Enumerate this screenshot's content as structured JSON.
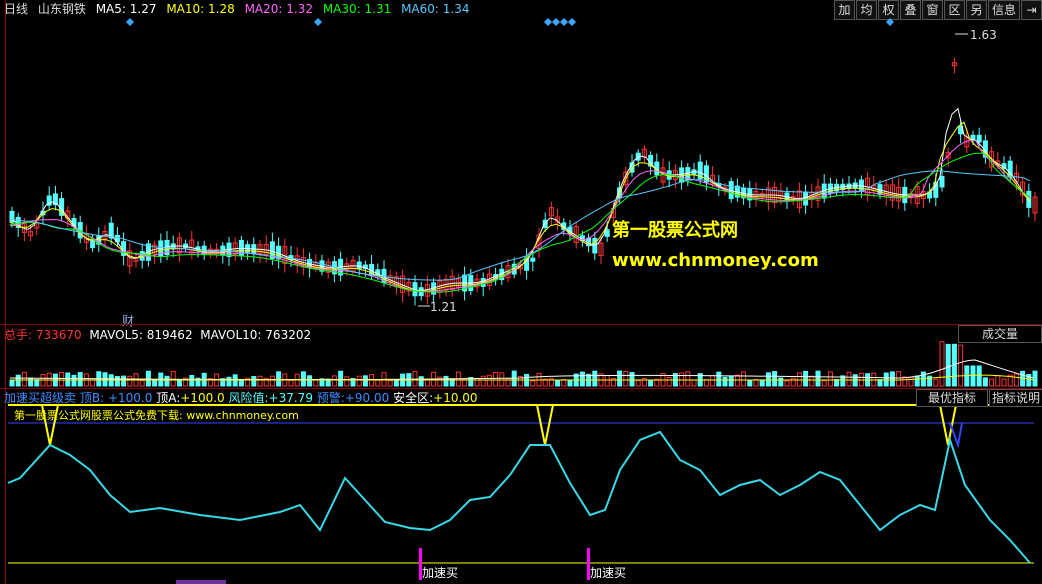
{
  "header": {
    "period": "日线",
    "stock": "山东钢铁",
    "ma": [
      {
        "label": "MA5:",
        "value": "1.27",
        "color": "#ffffff"
      },
      {
        "label": "MA10:",
        "value": "1.28",
        "color": "#ffff00"
      },
      {
        "label": "MA20:",
        "value": "1.32",
        "color": "#ff66ff"
      },
      {
        "label": "MA30:",
        "value": "1.31",
        "color": "#00ff00"
      },
      {
        "label": "MA60:",
        "value": "1.34",
        "color": "#55c8ff"
      }
    ]
  },
  "toolbar": [
    "加",
    "均",
    "权",
    "叠",
    "窗",
    "区",
    "另",
    "信息",
    "⇥"
  ],
  "price_panel": {
    "high_label": "1.63",
    "low_label": "1.21",
    "cai": "财",
    "watermark1": "第一股票公式网",
    "watermark2": "www.chnmoney.com"
  },
  "volume_panel": {
    "total_label": "总手:",
    "total_value": "733670",
    "mavol5_label": "MAVOL5:",
    "mavol5_value": "819462",
    "mavol10_label": "MAVOL10:",
    "mavol10_value": "763202",
    "dropdown": "成交量"
  },
  "indicator_panel": {
    "name": "加速买超级卖",
    "bottom_label": "顶B:",
    "bottom_value": "+100.0",
    "topA_label": "顶A:",
    "topA_value": "+100.0",
    "risk_label": "风险值:",
    "risk_value": "+37.79",
    "warn_label": "预警:",
    "warn_value": "+90.00",
    "safe_label": "安全区:",
    "safe_value": "+10.00",
    "banner": "第一股票公式网股票公式免费下载: www.chnmoney.com",
    "best_button": "最优指标",
    "explain_button": "指标说明",
    "buy_signals": [
      "加速买",
      "加速买"
    ]
  },
  "colors": {
    "up": "#ff3232",
    "down": "#54ffff",
    "grid": "#800000",
    "yellow": "#ffff00",
    "cyan": "#38d8e8",
    "blue": "#3344ff",
    "magenta": "#ff00ff"
  }
}
